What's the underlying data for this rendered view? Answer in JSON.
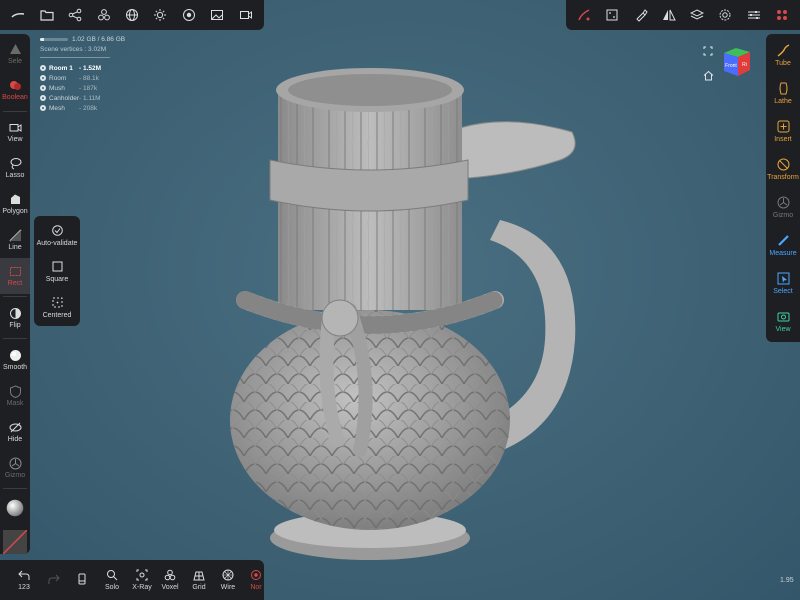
{
  "top_left_toolbar": {
    "items": [
      {
        "name": "brush-stroke-icon"
      },
      {
        "name": "folder-icon"
      },
      {
        "name": "scene-graph-icon"
      },
      {
        "name": "objects-icon"
      },
      {
        "name": "grid-sphere-icon"
      },
      {
        "name": "sun-icon"
      },
      {
        "name": "material-icon"
      },
      {
        "name": "image-icon"
      },
      {
        "name": "video-icon"
      }
    ]
  },
  "top_right_toolbar": {
    "items": [
      {
        "name": "brush-disabled-icon"
      },
      {
        "name": "dice-icon"
      },
      {
        "name": "paint-icon"
      },
      {
        "name": "symmetry-icon"
      },
      {
        "name": "layers-icon"
      },
      {
        "name": "settings-icon"
      },
      {
        "name": "sliders-icon"
      },
      {
        "name": "apps-icon"
      }
    ]
  },
  "info": {
    "memory": "1.02 GB / 6.86 GB",
    "memory_fraction": 0.15,
    "vertices": "Scene vertices : 3.02M",
    "meshes": [
      {
        "name": "Room 1",
        "count": "- 1.52M"
      },
      {
        "name": "Room",
        "count": "- 88.1k"
      },
      {
        "name": "Mush",
        "count": "- 187k"
      },
      {
        "name": "Canholder",
        "count": "- 1.11M"
      },
      {
        "name": "Mesh",
        "count": "- 208k"
      }
    ]
  },
  "left_toolbar": {
    "tools": [
      {
        "label": "Sele",
        "icon": "select-mask-icon"
      },
      {
        "label": "Boolean",
        "icon": "boolean-icon"
      },
      {
        "label": "View",
        "icon": "camera-icon"
      },
      {
        "label": "Lasso",
        "icon": "lasso-icon"
      },
      {
        "label": "Polygon",
        "icon": "polygon-icon"
      },
      {
        "label": "Line",
        "icon": "line-icon"
      },
      {
        "label": "Rect",
        "icon": "rect-icon"
      },
      {
        "label": "Flip",
        "icon": "flip-icon"
      },
      {
        "label": "Smooth",
        "icon": "smooth-icon"
      },
      {
        "label": "Mask",
        "icon": "mask-icon"
      },
      {
        "label": "Hide",
        "icon": "hide-icon"
      },
      {
        "label": "Gizmo",
        "icon": "gizmo-icon"
      }
    ]
  },
  "rect_popup": {
    "options": [
      {
        "label": "Auto-validate",
        "icon": "check-icon"
      },
      {
        "label": "Square",
        "icon": "square-icon"
      },
      {
        "label": "Centered",
        "icon": "centered-icon"
      }
    ]
  },
  "right_toolbar": {
    "tools": [
      {
        "label": "Tube",
        "icon": "tube-icon"
      },
      {
        "label": "Lathe",
        "icon": "lathe-icon"
      },
      {
        "label": "Insert",
        "icon": "insert-icon"
      },
      {
        "label": "Transform",
        "icon": "transform-icon"
      },
      {
        "label": "Gizmo",
        "icon": "gizmo-icon"
      },
      {
        "label": "Measure",
        "icon": "measure-icon"
      },
      {
        "label": "Select",
        "icon": "select-icon"
      },
      {
        "label": "View",
        "icon": "view-icon"
      }
    ]
  },
  "bottom_toolbar": {
    "undo_label": "123",
    "items": [
      {
        "label": "",
        "icon": "redo-icon"
      },
      {
        "label": "",
        "icon": "phone-icon"
      },
      {
        "label": "Solo",
        "icon": "search-icon"
      },
      {
        "label": "X-Ray",
        "icon": "xray-icon"
      },
      {
        "label": "Voxel",
        "icon": "voxel-icon"
      },
      {
        "label": "Grid",
        "icon": "grid-icon"
      },
      {
        "label": "Wire",
        "icon": "wire-icon"
      },
      {
        "label": "Nor",
        "icon": "normal-icon"
      }
    ]
  },
  "view_cube": {
    "front_label": "Front",
    "side_label": "Ri"
  },
  "version": "1.95"
}
